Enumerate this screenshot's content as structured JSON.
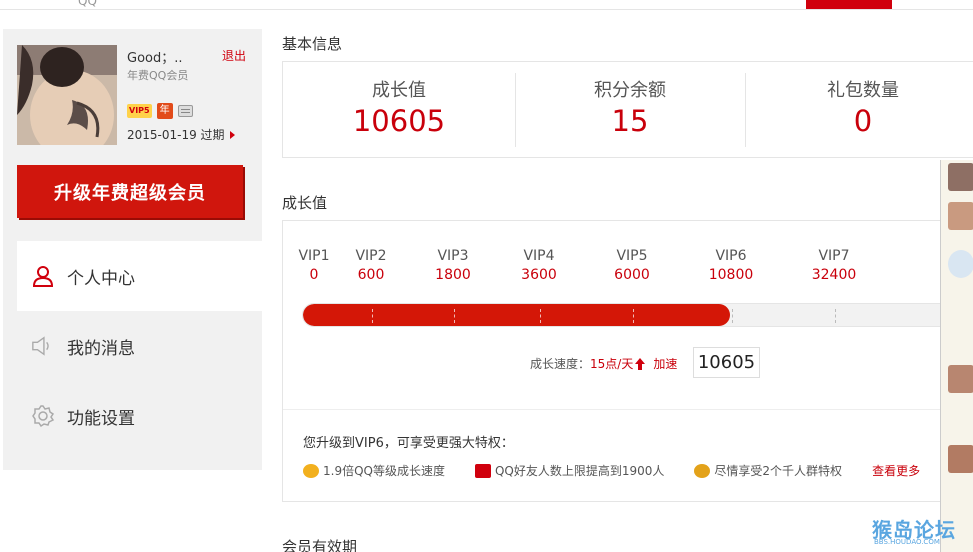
{
  "topbar": {
    "cut_text": "QQ"
  },
  "profile": {
    "username": "Good；..",
    "logout": "退出",
    "member_type": "年费QQ会员",
    "vip_badge": "VIP5",
    "year_badge": "年",
    "expiry": "2015-01-19 过期"
  },
  "upgrade_button": "升级年费超级会员",
  "nav": [
    {
      "label": "个人中心",
      "icon": "person-icon",
      "active": true
    },
    {
      "label": "我的消息",
      "icon": "speaker-icon",
      "active": false
    },
    {
      "label": "功能设置",
      "icon": "gear-icon",
      "active": false
    }
  ],
  "basic_info": {
    "title": "基本信息",
    "stats": [
      {
        "label": "成长值",
        "value": "10605"
      },
      {
        "label": "积分余额",
        "value": "15"
      },
      {
        "label": "礼包数量",
        "value": "0"
      }
    ]
  },
  "growth": {
    "title": "成长值",
    "levels": [
      {
        "name": "VIP1",
        "points": "0"
      },
      {
        "name": "VIP2",
        "points": "600"
      },
      {
        "name": "VIP3",
        "points": "1800"
      },
      {
        "name": "VIP4",
        "points": "3600"
      },
      {
        "name": "VIP5",
        "points": "6000"
      },
      {
        "name": "VIP6",
        "points": "10800"
      },
      {
        "name": "VIP7",
        "points": "32400"
      }
    ],
    "progress_fraction": 0.63,
    "speed_label": "成长速度：",
    "speed_value": "15点/天",
    "accelerate": "加速",
    "current_value": "10605"
  },
  "benefits": {
    "title": "您升级到VIP6，可享受更强大特权：",
    "items": [
      {
        "text": "1.9倍QQ等级成长速度",
        "icon": "smiley-icon",
        "color": "#f2b01e"
      },
      {
        "text": "QQ好友人数上限提高到1900人",
        "icon": "friends-icon",
        "color": "#d0000d"
      },
      {
        "text": "尽情享受2个千人群特权",
        "icon": "group-icon",
        "color": "#e3a21a"
      }
    ],
    "see_more": "查看更多"
  },
  "validity": {
    "title": "会员有效期"
  },
  "watermark": {
    "main": "猴岛论坛",
    "sub": "BBS.HOUDAO.COM"
  },
  "colors": {
    "accent": "#d0000d",
    "value_red": "#c9000b",
    "sidebar_bg": "#f1f1f1"
  }
}
